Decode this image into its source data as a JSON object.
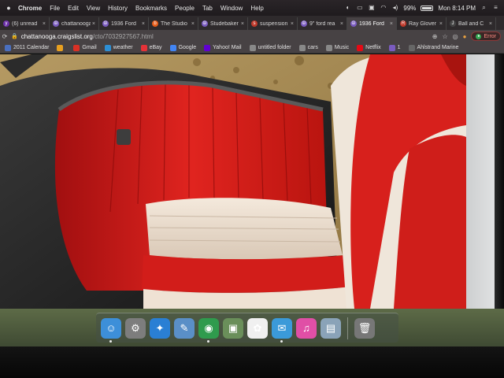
{
  "menubar": {
    "app": "Chrome",
    "menus": [
      "File",
      "Edit",
      "View",
      "History",
      "Bookmarks",
      "People",
      "Tab",
      "Window",
      "Help"
    ],
    "battery_label": "99%",
    "battery_level": 0.99,
    "clock": "Mon 8:14 PM"
  },
  "tabs": [
    {
      "title": "(6) unread",
      "favicon_color": "#6b2fa8",
      "favicon": "y"
    },
    {
      "title": "chattanooga",
      "favicon_color": "#7a5bbf",
      "favicon": "☮"
    },
    {
      "title": "1936 Ford",
      "favicon_color": "#7a5bbf",
      "favicon": "☮"
    },
    {
      "title": "The Studio",
      "favicon_color": "#e85d1a",
      "favicon": "b"
    },
    {
      "title": "Studebaker",
      "favicon_color": "#7a5bbf",
      "favicon": "☮"
    },
    {
      "title": "suspension",
      "favicon_color": "#c0392b",
      "favicon": "s"
    },
    {
      "title": "9\" ford rea",
      "favicon_color": "#7a5bbf",
      "favicon": "☮"
    },
    {
      "title": "1936 Ford",
      "favicon_color": "#7a5bbf",
      "favicon": "☮",
      "active": true
    },
    {
      "title": "Ray Glover",
      "favicon_color": "#c0392b",
      "favicon": "R"
    },
    {
      "title": "Ball and C",
      "favicon_color": "#444",
      "favicon": "J"
    }
  ],
  "toolbar": {
    "url_host": "chattanooga.craigslist.org",
    "url_path": "/cto/7032927567.html",
    "error_label": "Error"
  },
  "bookmarks": [
    {
      "label": "2011 Calendar",
      "icon": "calendar-icon",
      "color": "#4a6fbf"
    },
    {
      "label": "",
      "icon": "colorful-icon",
      "color": "#e8a020"
    },
    {
      "label": "Gmail",
      "icon": "google-icon",
      "color": "#d93025"
    },
    {
      "label": "weather",
      "icon": "weather-icon",
      "color": "#2d8fd5"
    },
    {
      "label": "eBay",
      "icon": "ebay-icon",
      "color": "#e53238"
    },
    {
      "label": "Google",
      "icon": "google-icon",
      "color": "#4285f4"
    },
    {
      "label": "Yahoo! Mail",
      "icon": "yahoo-icon",
      "color": "#6001d2"
    },
    {
      "label": "untitled folder",
      "icon": "folder-icon",
      "color": "#888"
    },
    {
      "label": "cars",
      "icon": "folder-icon",
      "color": "#888"
    },
    {
      "label": "Music",
      "icon": "folder-icon",
      "color": "#888"
    },
    {
      "label": "Netflix",
      "icon": "netflix-icon",
      "color": "#e50914"
    },
    {
      "label": "1",
      "icon": "peace-icon",
      "color": "#7a5bbf"
    },
    {
      "label": "Ahlstrand Marine",
      "icon": "globe-icon",
      "color": "#666"
    }
  ],
  "dock": [
    {
      "name": "finder-app",
      "glyph": "☺",
      "color": "#3d8fd9",
      "running": true
    },
    {
      "name": "system-preferences-app",
      "glyph": "⚙",
      "color": "#7d7d7d"
    },
    {
      "name": "safari-app",
      "glyph": "✦",
      "color": "#2a7fd4"
    },
    {
      "name": "preview-app",
      "glyph": "✎",
      "color": "#5a8fc7"
    },
    {
      "name": "chrome-app",
      "glyph": "◉",
      "color": "#2f9b4d",
      "running": true
    },
    {
      "name": "image-capture-app",
      "glyph": "▣",
      "color": "#6a8f5a"
    },
    {
      "name": "photos-app",
      "glyph": "✿",
      "color": "#f0f0f0"
    },
    {
      "name": "messages-app",
      "glyph": "✉",
      "color": "#3b9ad9",
      "running": true
    },
    {
      "name": "itunes-app",
      "glyph": "♫",
      "color": "#e04fa6"
    },
    {
      "name": "image-viewer-app",
      "glyph": "▤",
      "color": "#8aa3b8"
    },
    {
      "name": "trash-app",
      "glyph": "🗑",
      "color": "#777"
    }
  ]
}
